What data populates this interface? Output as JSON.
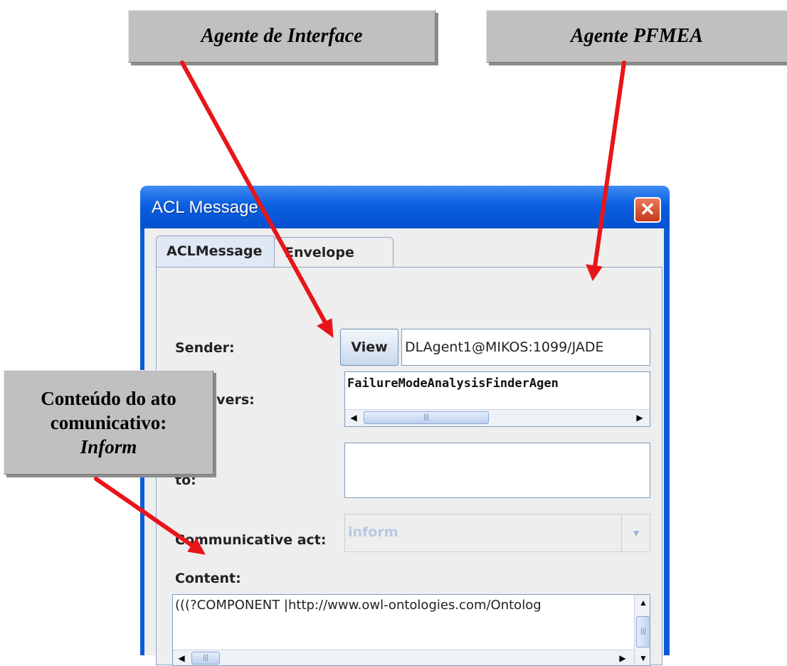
{
  "annotations": {
    "interface_agent": "Agente de Interface",
    "pfmea_agent": "Agente PFMEA",
    "content_line1": "Conteúdo do ato",
    "content_line2": "comunicativo:",
    "content_line3": "Inform"
  },
  "window": {
    "title": "ACL Message",
    "close_glyph": "✕"
  },
  "tabs": [
    {
      "label": "ACLMessage",
      "selected": true
    },
    {
      "label": "Envelope",
      "selected": false
    }
  ],
  "form": {
    "sender_label": "Sender:",
    "view_label": "View",
    "sender_value": "DLAgent1@MIKOS:1099/JADE",
    "receivers_label": "Receivers:",
    "receivers_value": "FailureModeAnalysisFinderAgen",
    "reply_to_label": "to:",
    "communicative_act_label": "Communicative act:",
    "communicative_act_value": "inform",
    "content_label": "Content:",
    "content_value": "(((?COMPONENT |http://www.owl-ontologies.com/Ontolog"
  },
  "icons": {
    "left_arrow": "◀",
    "right_arrow": "▶",
    "up_arrow": "▲",
    "down_arrow": "▼",
    "grip": "|||",
    "combo_arrow": "▼"
  },
  "colors": {
    "arrow": "#e8151a",
    "callout": "#c0c0c0",
    "titlebar": "#0a5fe0"
  }
}
